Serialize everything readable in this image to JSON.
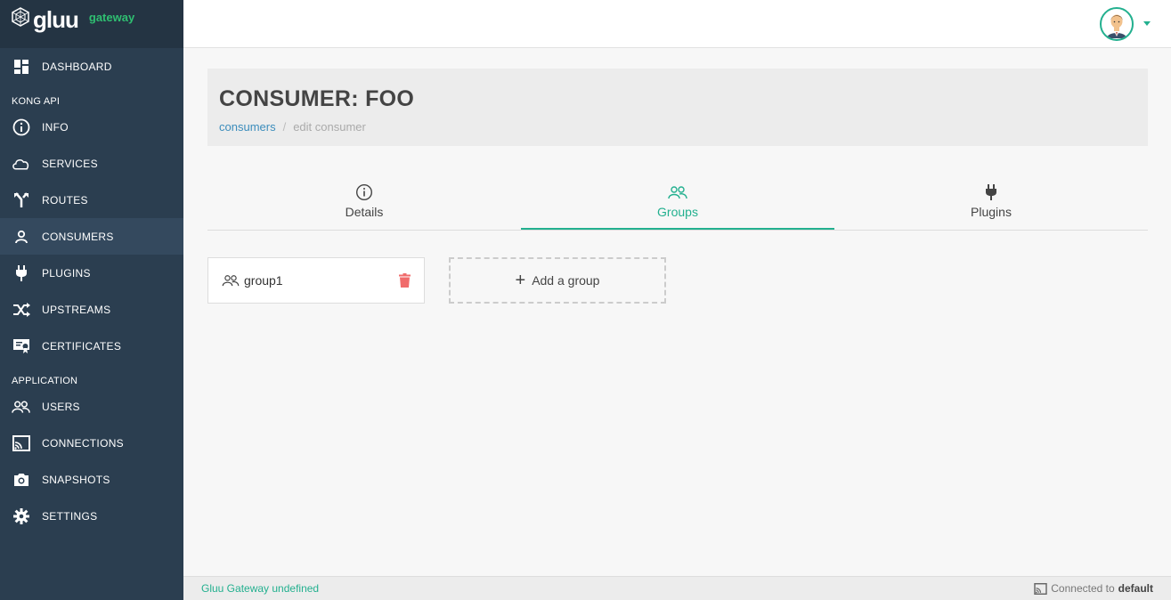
{
  "brand": {
    "name": "gluu",
    "sub": "gateway"
  },
  "sidebar": {
    "dashboard": "DASHBOARD",
    "section_kong": "KONG API",
    "kong_items": [
      {
        "label": "INFO"
      },
      {
        "label": "SERVICES"
      },
      {
        "label": "ROUTES"
      },
      {
        "label": "CONSUMERS"
      },
      {
        "label": "PLUGINS"
      },
      {
        "label": "UPSTREAMS"
      },
      {
        "label": "CERTIFICATES"
      }
    ],
    "section_app": "APPLICATION",
    "app_items": [
      {
        "label": "USERS"
      },
      {
        "label": "CONNECTIONS"
      },
      {
        "label": "SNAPSHOTS"
      },
      {
        "label": "SETTINGS"
      }
    ],
    "active": "CONSUMERS"
  },
  "header": {
    "title": "CONSUMER: FOO",
    "breadcrumb": {
      "link": "consumers",
      "current": "edit consumer"
    }
  },
  "tabs": [
    {
      "label": "Details",
      "icon": "info-icon"
    },
    {
      "label": "Groups",
      "icon": "groups-icon"
    },
    {
      "label": "Plugins",
      "icon": "plug-icon"
    }
  ],
  "active_tab": "Groups",
  "groups": [
    {
      "name": "group1"
    }
  ],
  "add_group_label": "Add a group",
  "footer": {
    "left": "Gluu Gateway undefined",
    "right_prefix": "Connected to",
    "right_value": "default"
  },
  "colors": {
    "accent": "#23b08f",
    "sidebar": "#2b3e50",
    "danger": "#f06b6b",
    "link": "#3c8dbc"
  }
}
